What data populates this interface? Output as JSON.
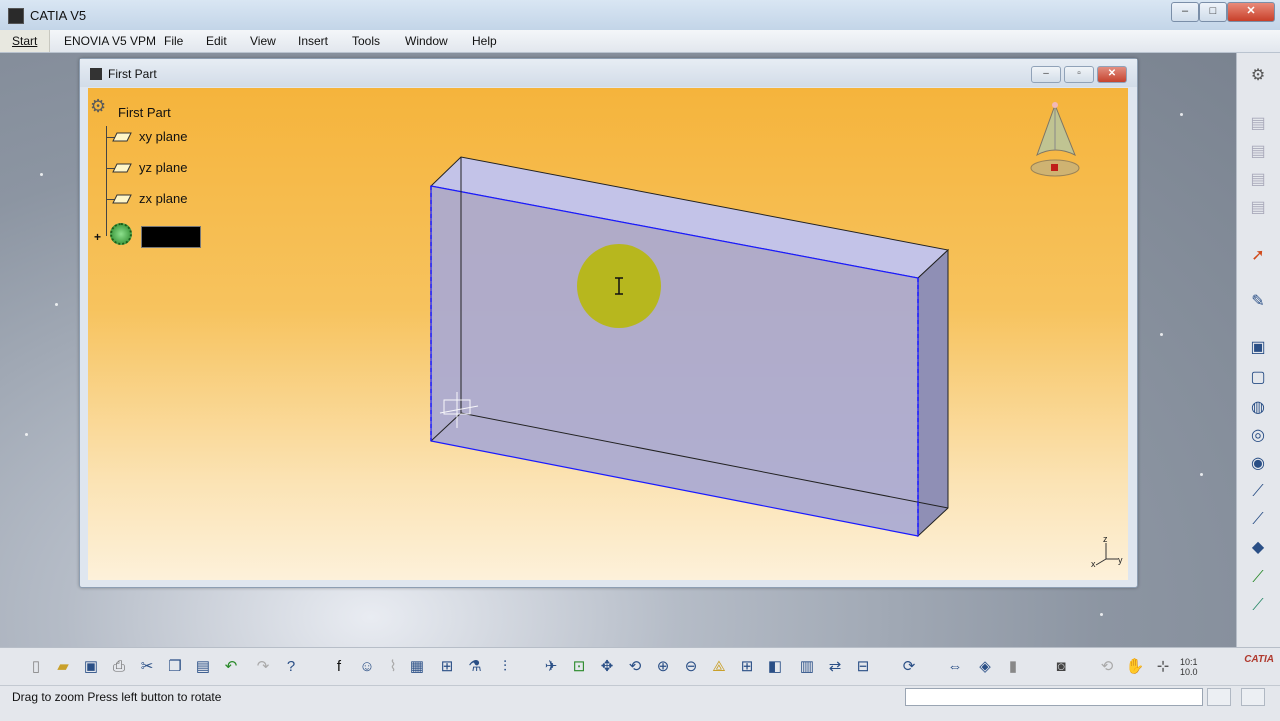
{
  "app": {
    "title": "CATIA V5",
    "window_controls": [
      "–",
      "□",
      "✕"
    ]
  },
  "menubar": {
    "items": [
      "Start",
      "ENOVIA V5 VPM",
      "File",
      "Edit",
      "View",
      "Insert",
      "Tools",
      "Window",
      "Help"
    ]
  },
  "document": {
    "title": "First Part",
    "window_controls": [
      "–",
      "▫",
      "✕"
    ]
  },
  "tree": {
    "root": "First Part",
    "planes": [
      "xy plane",
      "yz plane",
      "zx plane"
    ],
    "body_rename_value": ""
  },
  "axis": {
    "z": "z",
    "x": "x",
    "y": "y"
  },
  "status": {
    "message": "Drag to zoom  Press left button to rotate",
    "command_value": ""
  },
  "bottom_toolbar": {
    "zoom_readout": "10:1\n10.0",
    "logo": "CATIA"
  },
  "colors": {
    "viewport_top": "#f5b43c",
    "viewport_bottom": "#fdf1da",
    "solid_fill": "#a9a9d3",
    "edge_highlight": "#1a1aff",
    "cursor_highlight": "#c8c800"
  },
  "icons": {
    "right_toolbar": [
      "gear-icon",
      "part-body-icon",
      "body-insert-icon",
      "boolean-icon",
      "union-trim-icon",
      "select-arrow-icon",
      "sketch-icon",
      "pad-icon",
      "pocket-icon",
      "shaft-icon",
      "groove-icon",
      "hole-icon",
      "rib-icon",
      "slot-icon",
      "solid-combine-icon",
      "stiffener-icon",
      "loft-icon"
    ],
    "bottom_toolbar": [
      "new-icon",
      "open-icon",
      "save-icon",
      "print-icon",
      "cut-icon",
      "copy-icon",
      "paste-icon",
      "undo-icon",
      "redo-icon",
      "help-icon",
      "formula-icon",
      "knowledge-icon",
      "table-icon",
      "design-table-icon",
      "law-icon",
      "measure-icon",
      "analysis-icon",
      "fly-mode-icon",
      "fit-all-icon",
      "pan-icon",
      "rotate-icon",
      "zoom-in-icon",
      "zoom-out-icon",
      "normal-view-icon",
      "quick-view-icon",
      "view-mode-icon",
      "hide-show-icon",
      "swap-space-icon",
      "properties-icon",
      "update-icon",
      "measure-between-icon",
      "apply-material-icon",
      "capture-icon",
      "rotate-3d-icon",
      "pan-3d-icon",
      "coords-icon"
    ]
  }
}
